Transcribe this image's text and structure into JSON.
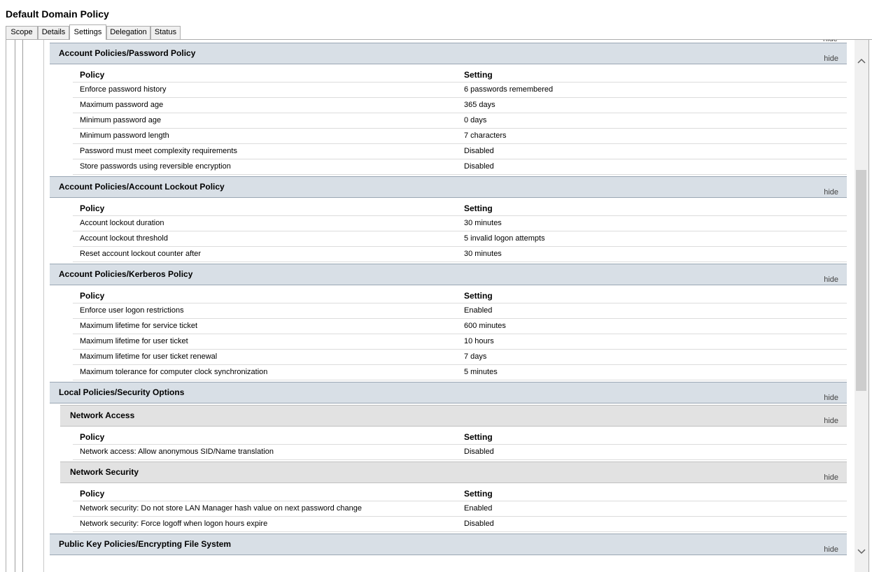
{
  "window": {
    "title": "Default Domain Policy"
  },
  "tabs": [
    "Scope",
    "Details",
    "Settings",
    "Delegation",
    "Status"
  ],
  "active_tab": "Settings",
  "hide_label": "hide",
  "columns": {
    "policy": "Policy",
    "setting": "Setting"
  },
  "sections": [
    {
      "title": "Account Policies/Password Policy",
      "rows": [
        {
          "policy": "Enforce password history",
          "setting": "6 passwords remembered"
        },
        {
          "policy": "Maximum password age",
          "setting": "365 days"
        },
        {
          "policy": "Minimum password age",
          "setting": "0 days"
        },
        {
          "policy": "Minimum password length",
          "setting": "7 characters"
        },
        {
          "policy": "Password must meet complexity requirements",
          "setting": "Disabled"
        },
        {
          "policy": "Store passwords using reversible encryption",
          "setting": "Disabled"
        }
      ]
    },
    {
      "title": "Account Policies/Account Lockout Policy",
      "rows": [
        {
          "policy": "Account lockout duration",
          "setting": "30 minutes"
        },
        {
          "policy": "Account lockout threshold",
          "setting": "5 invalid logon attempts"
        },
        {
          "policy": "Reset account lockout counter after",
          "setting": "30 minutes"
        }
      ]
    },
    {
      "title": "Account Policies/Kerberos Policy",
      "rows": [
        {
          "policy": "Enforce user logon restrictions",
          "setting": "Enabled"
        },
        {
          "policy": "Maximum lifetime for service ticket",
          "setting": "600 minutes"
        },
        {
          "policy": "Maximum lifetime for user ticket",
          "setting": "10 hours"
        },
        {
          "policy": "Maximum lifetime for user ticket renewal",
          "setting": "7 days"
        },
        {
          "policy": "Maximum tolerance for computer clock synchronization",
          "setting": "5 minutes"
        }
      ]
    },
    {
      "title": "Local Policies/Security Options",
      "subsections": [
        {
          "title": "Network Access",
          "rows": [
            {
              "policy": "Network access: Allow anonymous SID/Name translation",
              "setting": "Disabled"
            }
          ]
        },
        {
          "title": "Network Security",
          "rows": [
            {
              "policy": "Network security: Do not store LAN Manager hash value on next password change",
              "setting": "Enabled"
            },
            {
              "policy": "Network security: Force logoff when logon hours expire",
              "setting": "Disabled"
            }
          ]
        }
      ]
    },
    {
      "title": "Public Key Policies/Encrypting File System"
    }
  ],
  "scrollbar": {
    "up_glyph": "^",
    "down_glyph": "v"
  }
}
